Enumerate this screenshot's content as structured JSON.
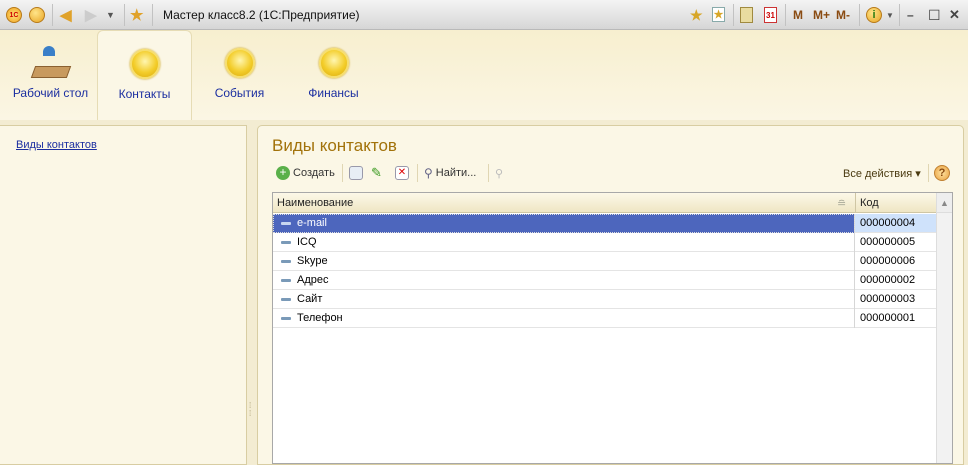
{
  "window": {
    "title": "Мастер класс8.2  (1С:Предприятие)",
    "memory_buttons": [
      "M",
      "M+",
      "M-"
    ]
  },
  "sections": [
    {
      "label": "Рабочий стол"
    },
    {
      "label": "Контакты"
    },
    {
      "label": "События"
    },
    {
      "label": "Финансы"
    }
  ],
  "nav": {
    "link": "Виды контактов"
  },
  "main": {
    "title": "Виды контактов",
    "toolbar": {
      "create": "Создать",
      "find": "Найти...",
      "all_actions": "Все действия ▾",
      "help": "?"
    },
    "columns": [
      "Наименование",
      "Код"
    ],
    "rows": [
      {
        "name": "e-mail",
        "code": "000000004"
      },
      {
        "name": "ICQ",
        "code": "000000005"
      },
      {
        "name": "Skype",
        "code": "000000006"
      },
      {
        "name": "Адрес",
        "code": "000000002"
      },
      {
        "name": "Сайт",
        "code": "000000003"
      },
      {
        "name": "Телефон",
        "code": "000000001"
      }
    ]
  }
}
